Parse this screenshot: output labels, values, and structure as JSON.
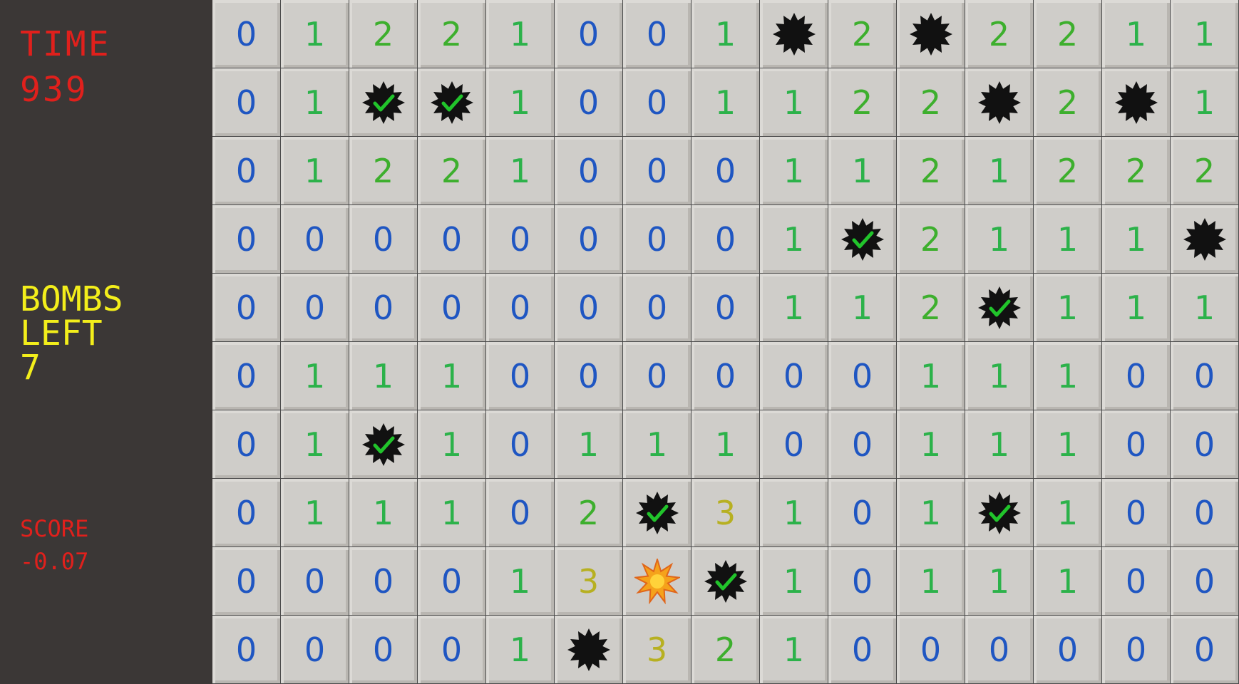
{
  "sidebar": {
    "time_label": "TIME",
    "time_value": "939",
    "bombs_left_line1": "BOMBS",
    "bombs_left_line2": "LEFT",
    "bombs_left_value": "7",
    "score_label": "SCORE",
    "score_value": "-0.07"
  },
  "colors": {
    "number_0": "#1f56c2",
    "number_1": "#2cb24a",
    "number_2": "#3daf2d",
    "number_3": "#b7b021",
    "mine": "#111111",
    "flag_check": "#21c42b",
    "explosion": "#f5a21b"
  },
  "legend": {
    "M": "mine-icon",
    "F": "flagged-mine-icon",
    "X": "exploded-mine-icon"
  },
  "board": {
    "rows": [
      [
        "0",
        "1",
        "2",
        "2",
        "1",
        "0",
        "0",
        "1",
        "M",
        "2",
        "M",
        "2",
        "2",
        "1",
        "1"
      ],
      [
        "0",
        "1",
        "F",
        "F",
        "1",
        "0",
        "0",
        "1",
        "1",
        "2",
        "2",
        "M",
        "2",
        "M",
        "1"
      ],
      [
        "0",
        "1",
        "2",
        "2",
        "1",
        "0",
        "0",
        "0",
        "1",
        "1",
        "2",
        "1",
        "2",
        "2",
        "2"
      ],
      [
        "0",
        "0",
        "0",
        "0",
        "0",
        "0",
        "0",
        "0",
        "1",
        "F",
        "2",
        "1",
        "1",
        "1",
        "M"
      ],
      [
        "0",
        "0",
        "0",
        "0",
        "0",
        "0",
        "0",
        "0",
        "1",
        "1",
        "2",
        "F",
        "1",
        "1",
        "1"
      ],
      [
        "0",
        "1",
        "1",
        "1",
        "0",
        "0",
        "0",
        "0",
        "0",
        "0",
        "1",
        "1",
        "1",
        "0",
        "0"
      ],
      [
        "0",
        "1",
        "F",
        "1",
        "0",
        "1",
        "1",
        "1",
        "0",
        "0",
        "1",
        "1",
        "1",
        "0",
        "0"
      ],
      [
        "0",
        "1",
        "1",
        "1",
        "0",
        "2",
        "F",
        "3",
        "1",
        "0",
        "1",
        "F",
        "1",
        "0",
        "0"
      ],
      [
        "0",
        "0",
        "0",
        "0",
        "1",
        "3",
        "X",
        "F",
        "1",
        "0",
        "1",
        "1",
        "1",
        "0",
        "0"
      ],
      [
        "0",
        "0",
        "0",
        "0",
        "1",
        "M",
        "3",
        "2",
        "1",
        "0",
        "0",
        "0",
        "0",
        "0",
        "0"
      ]
    ]
  }
}
